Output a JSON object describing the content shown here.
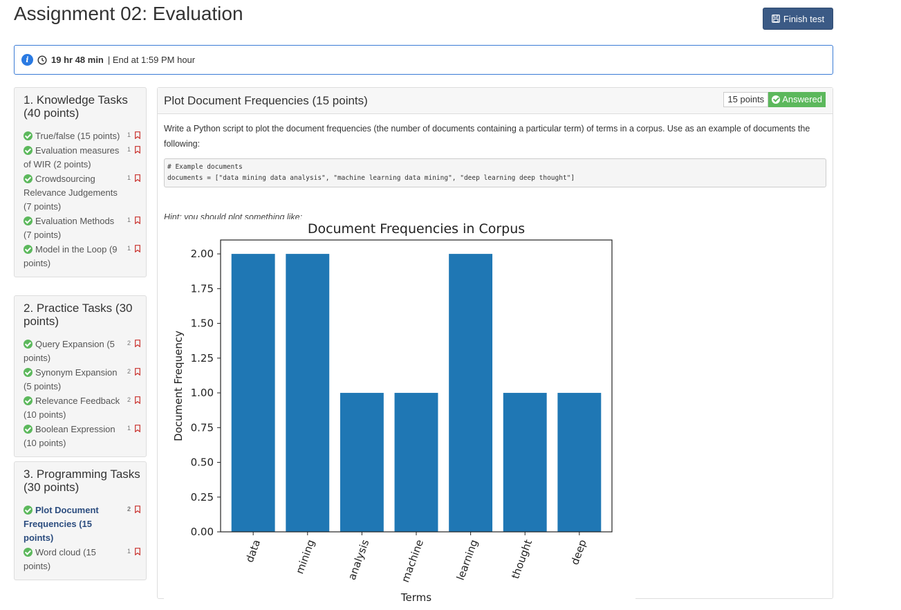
{
  "header": {
    "title": "Assignment 02: Evaluation",
    "finish_label": "Finish test"
  },
  "timer": {
    "remaining": "19 hr 48 min",
    "end_text": "| End at 1:59 PM hour"
  },
  "sections": [
    {
      "title": "1. Knowledge Tasks (40 points)",
      "items": [
        {
          "label": "True/false (15 points)",
          "pts": "1"
        },
        {
          "label": "Evaluation measures of WIR (2 points)",
          "pts": "1"
        },
        {
          "label": "Crowdsourcing Relevance Judgements (7 points)",
          "pts": "1"
        },
        {
          "label": "Evaluation Methods (7 points)",
          "pts": "1"
        },
        {
          "label": "Model in the Loop (9 points)",
          "pts": "1"
        }
      ]
    },
    {
      "title": "2. Practice Tasks (30 points)",
      "items": [
        {
          "label": "Query Expansion (5 points)",
          "pts": "2"
        },
        {
          "label": "Synonym Expansion (5 points)",
          "pts": "2"
        },
        {
          "label": "Relevance Feedback (10 points)",
          "pts": "2"
        },
        {
          "label": "Boolean Expression (10 points)",
          "pts": "1"
        }
      ]
    },
    {
      "title": "3. Programming Tasks (30 points)",
      "items": [
        {
          "label": "Plot Document Frequencies (15 points)",
          "pts": "2",
          "active": true
        },
        {
          "label": "Word cloud (15 points)",
          "pts": "1"
        }
      ]
    }
  ],
  "question": {
    "title": "Plot Document Frequencies (15 points)",
    "points_badge": "15 points",
    "status_badge": "Answered",
    "text": "Write a Python script to plot the document frequencies (the number of documents containing a particular term) of terms in a corpus. Use as an example of documents the following:",
    "code_line1": "# Example documents",
    "code_line2": "documents = [\"data mining data analysis\", \"machine learning data mining\", \"deep learning deep thought\"]",
    "hint": "Hint: you should plot something like:"
  },
  "colors": {
    "accent": "#3b5a85",
    "success": "#5cb85c",
    "bar": "#1f77b4",
    "info": "#2a7ae2"
  },
  "chart_data": {
    "type": "bar",
    "title": "Document Frequencies in Corpus",
    "xlabel": "Terms",
    "ylabel": "Document Frequency",
    "categories": [
      "data",
      "mining",
      "analysis",
      "machine",
      "learning",
      "thought",
      "deep"
    ],
    "values": [
      2,
      2,
      1,
      1,
      2,
      1,
      1
    ],
    "ylim": [
      0,
      2.1
    ],
    "yticks": [
      "0.00",
      "0.25",
      "0.50",
      "0.75",
      "1.00",
      "1.25",
      "1.50",
      "1.75",
      "2.00"
    ],
    "grid": false
  }
}
